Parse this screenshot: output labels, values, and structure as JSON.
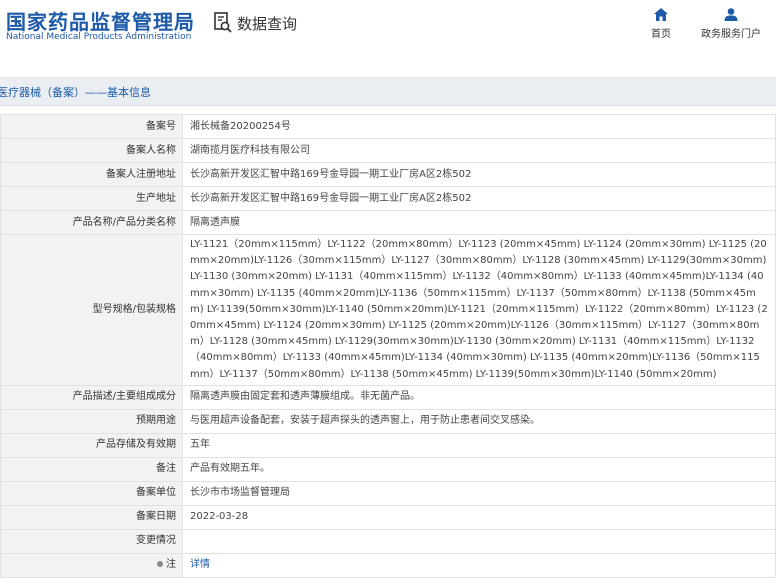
{
  "header": {
    "logo_cn": "国家药品监督管理局",
    "logo_en": "National Medical Products Administration",
    "query_label": "数据查询",
    "nav": [
      {
        "label": "首页",
        "icon": "home-icon"
      },
      {
        "label": "政务服务门户",
        "icon": "user-icon"
      }
    ]
  },
  "breadcrumb": "医疗器械（备案）——基本信息",
  "rows": [
    {
      "label": "备案号",
      "value": "湘长械备20200254号"
    },
    {
      "label": "备案人名称",
      "value": "湖南揽月医疗科技有限公司"
    },
    {
      "label": "备案人注册地址",
      "value": "长沙高新开发区汇智中路169号金导园一期工业厂房A区2栋502"
    },
    {
      "label": "生产地址",
      "value": "长沙高新开发区汇智中路169号金导园一期工业厂房A区2栋502"
    },
    {
      "label": "产品名称/产品分类名称",
      "value": "隔离透声膜"
    },
    {
      "label": "型号规格/包装规格",
      "value": "LY-1121（20mm×115mm）LY-1122（20mm×80mm）LY-1123 (20mm×45mm) LY-1124 (20mm×30mm) LY-1125 (20mm×20mm)LY-1126（30mm×115mm）LY-1127（30mm×80mm）LY-1128 (30mm×45mm) LY-1129(30mm×30mm)LY-1130 (30mm×20mm) LY-1131（40mm×115mm）LY-1132（40mm×80mm）LY-1133 (40mm×45mm)LY-1134 (40mm×30mm) LY-1135 (40mm×20mm)LY-1136（50mm×115mm）LY-1137（50mm×80mm）LY-1138 (50mm×45mm) LY-1139(50mm×30mm)LY-1140 (50mm×20mm)LY-1121（20mm×115mm）LY-1122（20mm×80mm）LY-1123 (20mm×45mm) LY-1124 (20mm×30mm) LY-1125 (20mm×20mm)LY-1126（30mm×115mm）LY-1127（30mm×80mm）LY-1128 (30mm×45mm) LY-1129(30mm×30mm)LY-1130 (30mm×20mm) LY-1131（40mm×115mm）LY-1132（40mm×80mm）LY-1133 (40mm×45mm)LY-1134 (40mm×30mm) LY-1135 (40mm×20mm)LY-1136（50mm×115mm）LY-1137（50mm×80mm）LY-1138 (50mm×45mm) LY-1139(50mm×30mm)LY-1140 (50mm×20mm)"
    },
    {
      "label": "产品描述/主要组成成分",
      "value": "隔离透声膜由固定套和透声薄膜组成。非无菌产品。"
    },
    {
      "label": "预期用途",
      "value": "与医用超声设备配套，安装于超声探头的透声窗上，用于防止患者间交叉感染。"
    },
    {
      "label": "产品存储及有效期",
      "value": "五年"
    },
    {
      "label": "备注",
      "value": "产品有效期五年。"
    },
    {
      "label": "备案单位",
      "value": "长沙市市场监督管理局"
    },
    {
      "label": "备案日期",
      "value": "2022-03-28"
    },
    {
      "label": "变更情况",
      "value": ""
    },
    {
      "label": "注",
      "value": "详情"
    }
  ],
  "colors": {
    "brand": "#1d5aa8",
    "label_bg": "#f2f2f2",
    "title_bg": "#eaeef2"
  }
}
